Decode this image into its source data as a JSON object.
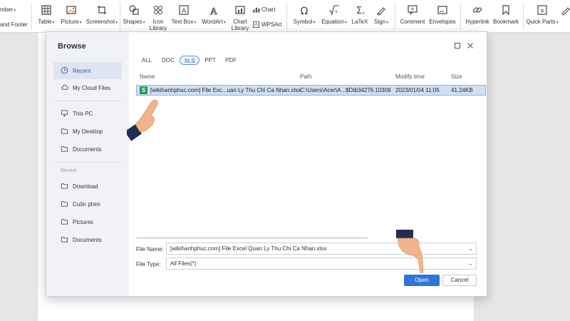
{
  "ribbon": {
    "items": [
      {
        "label": "mber",
        "caret": true
      },
      {
        "label": "and Footer"
      },
      {
        "label": "Table",
        "caret": true,
        "icon": "table-icon"
      },
      {
        "label": "Picture",
        "caret": true,
        "icon": "picture-icon"
      },
      {
        "label": "Screenshot",
        "caret": true,
        "icon": "screenshot-icon"
      },
      {
        "label": "Shapes",
        "caret": true,
        "icon": "shapes-icon"
      },
      {
        "label": "Icon Library",
        "icon": "icon-library-icon"
      },
      {
        "label": "Text Box",
        "caret": true,
        "icon": "text-box-icon"
      },
      {
        "label": "WordArt",
        "caret": true,
        "icon": "wordart-icon"
      },
      {
        "label": "Chart",
        "icon": "chart-icon"
      },
      {
        "label": "Chart Library",
        "icon": "chart-library-icon"
      },
      {
        "label": "WPSArt",
        "icon": "wpsart-icon"
      },
      {
        "label": "Symbol",
        "caret": true,
        "icon": "symbol-icon"
      },
      {
        "label": "Equation",
        "caret": true,
        "icon": "equation-icon"
      },
      {
        "label": "LaTeX",
        "icon": "latex-icon"
      },
      {
        "label": "Sign",
        "caret": true,
        "icon": "sign-icon"
      },
      {
        "label": "Comment",
        "icon": "comment-icon"
      },
      {
        "label": "Envelopes",
        "icon": "envelopes-icon"
      },
      {
        "label": "Hyperlink",
        "icon": "hyperlink-icon"
      },
      {
        "label": "Bookmark",
        "icon": "bookmark-icon"
      },
      {
        "label": "Quick Parts",
        "caret": true,
        "icon": "quick-parts-icon"
      }
    ],
    "caret_glyph": "▾"
  },
  "dialog": {
    "title": "Browse",
    "sidebar": {
      "items": [
        {
          "label": "Recent",
          "icon": "clock-icon",
          "active": true
        },
        {
          "label": "My Cloud Files",
          "icon": "cloud-icon"
        },
        {
          "label": "This PC",
          "icon": "monitor-icon"
        },
        {
          "label": "My Desktop",
          "icon": "folder-icon"
        },
        {
          "label": "Documents",
          "icon": "folder-icon"
        }
      ],
      "recent_heading": "Recent",
      "recent_items": [
        {
          "label": "Download",
          "icon": "folder-icon"
        },
        {
          "label": "Cuộn phim",
          "icon": "folder-icon"
        },
        {
          "label": "Pictures",
          "icon": "folder-icon"
        },
        {
          "label": "Documents",
          "icon": "folder-icon"
        }
      ]
    },
    "filters": [
      "ALL",
      "DOC",
      "XLS",
      "PPT",
      "PDF"
    ],
    "active_filter": "XLS",
    "columns": {
      "name": "Name",
      "path": "Path",
      "modify_time": "Modify time",
      "size": "Size"
    },
    "files": [
      {
        "icon_letter": "S",
        "name": "[wikihanhphuc.com] File Exc...uan Ly Thu Chi Ca Nhan.xlsx",
        "path": "C:\\Users\\Acer\\A...$DIb34276.10309",
        "modify_time": "2023/01/04 11:05",
        "size": "41.24KB"
      }
    ],
    "file_name_label": "File Name:",
    "file_name_value": "[wikihanhphuc.com] File Excel Quan Ly Thu Chi Ca Nhan.xlsx",
    "file_type_label": "File Type:",
    "file_type_value": "All Files(*)",
    "open_label": "Open",
    "cancel_label": "Cancel",
    "dropdown_glyph": "⌄"
  },
  "colors": {
    "accent": "#2f74d8",
    "selected_row": "#cfe0f6",
    "xls_green": "#1f9d55",
    "sidebar_bg": "#f0f2f7"
  }
}
